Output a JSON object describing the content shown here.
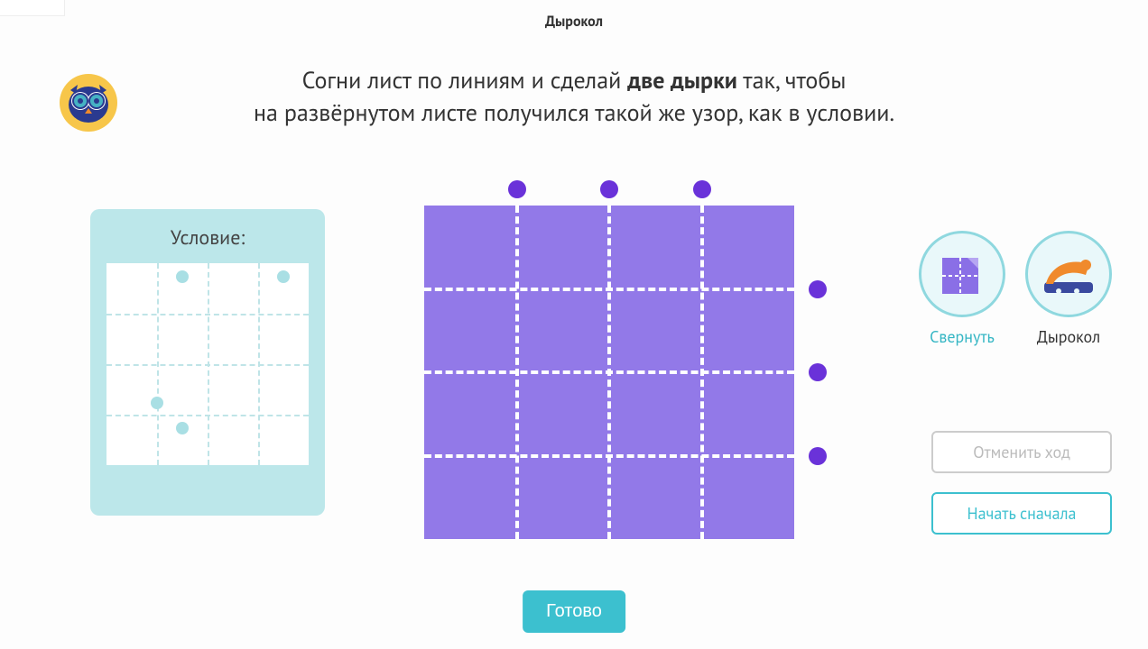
{
  "header": {
    "title": "Дырокол"
  },
  "instruction": {
    "line1_pre": "Согни лист по линиям и сделай ",
    "line1_bold": "две дырки",
    "line1_post": " так, чтобы",
    "line2": "на развёрнутом листе получился такой же узор, как в условии."
  },
  "condition": {
    "title": "Условие:",
    "grid": {
      "rows": 4,
      "cols": 4
    },
    "dots": [
      {
        "col": 1,
        "row": 0
      },
      {
        "col": 3,
        "row": 0
      },
      {
        "col": 0.5,
        "row": 2.5
      },
      {
        "col": 1,
        "row": 3
      }
    ]
  },
  "paper": {
    "rows": 4,
    "cols": 4,
    "top_markers_cols": [
      1,
      2,
      3
    ],
    "right_markers_rows": [
      1,
      2,
      3
    ]
  },
  "tools": {
    "fold": {
      "label": "Свернуть",
      "active": true
    },
    "punch": {
      "label": "Дырокол",
      "active": false
    }
  },
  "buttons": {
    "undo": "Отменить ход",
    "restart": "Начать сначала",
    "done": "Готово"
  }
}
